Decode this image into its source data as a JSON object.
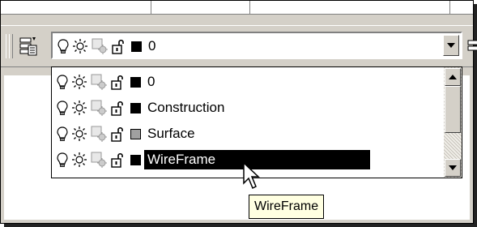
{
  "combo": {
    "current_layer": "0",
    "current_color": "#000000"
  },
  "layers": [
    {
      "name": "0",
      "color": "#000000",
      "selected": false
    },
    {
      "name": "Construction",
      "color": "#000000",
      "selected": false
    },
    {
      "name": "Surface",
      "color": "#a0a0a0",
      "selected": false
    },
    {
      "name": "WireFrame",
      "color": "#000000",
      "selected": true
    }
  ],
  "tooltip": {
    "text": "WireFrame"
  },
  "icons": {
    "on_off": "lightbulb-icon",
    "freeze": "sun-icon",
    "viewport_freeze": "viewport-freeze-icon",
    "lock": "unlock-icon",
    "layer_manager": "layer-properties-icon"
  },
  "colors": {
    "selection_bg": "#000000",
    "selection_text": "#ffffff",
    "tooltip_bg": "#ffffe1",
    "chrome": "#d4d0c8"
  }
}
